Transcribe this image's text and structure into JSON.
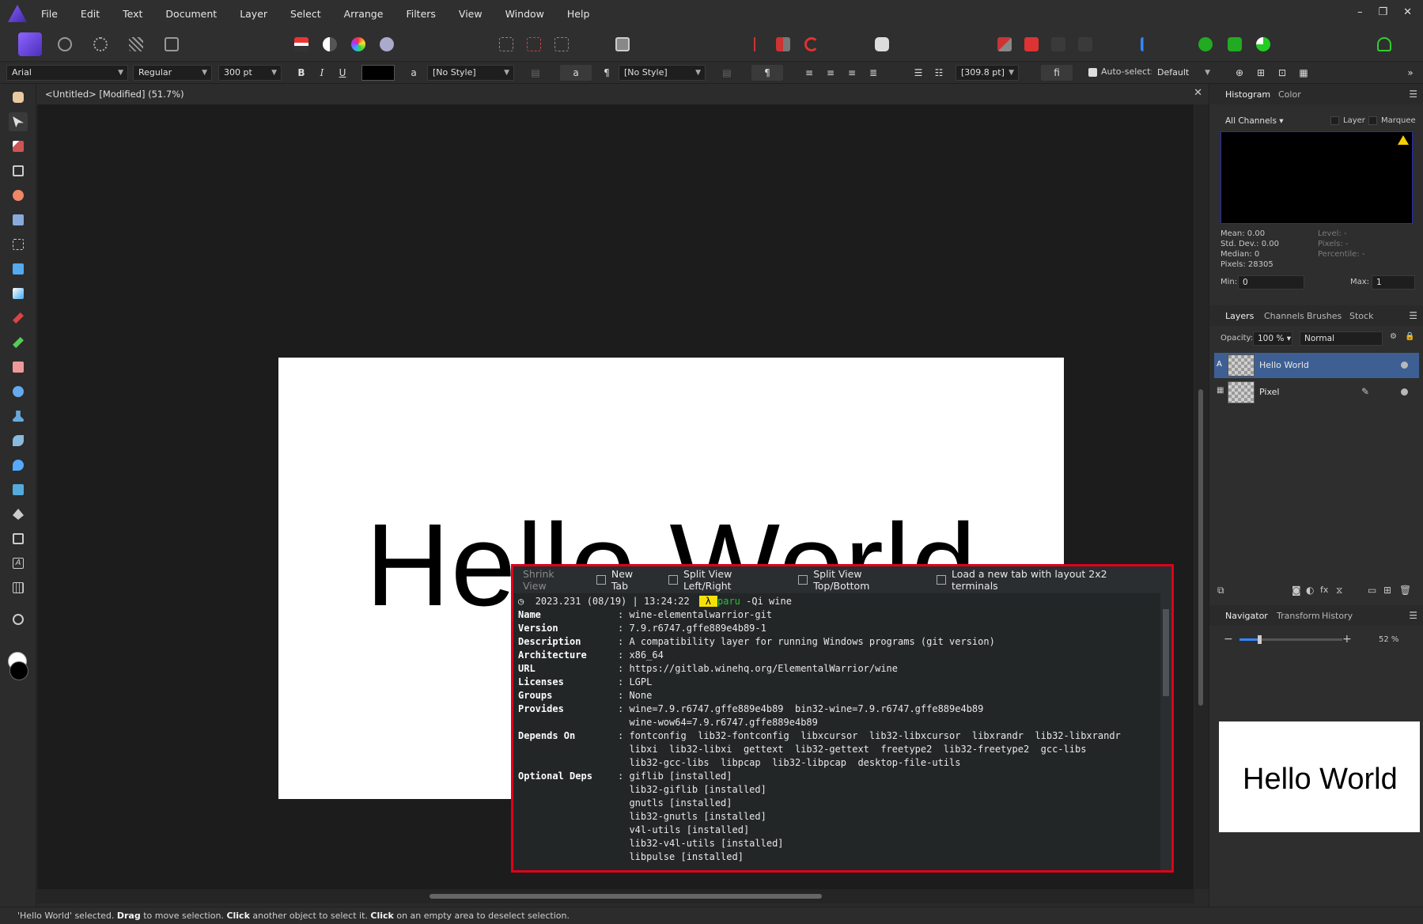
{
  "menubar": {
    "items": [
      "File",
      "Edit",
      "Text",
      "Document",
      "Layer",
      "Select",
      "Arrange",
      "Filters",
      "View",
      "Window",
      "Help"
    ],
    "window_controls": [
      "–",
      "❐",
      "✕"
    ]
  },
  "context_toolbar": {
    "font_family": "Arial",
    "font_style": "Regular",
    "font_size": "300 pt",
    "bold": "B",
    "italic": "I",
    "underline": "U",
    "char_style_glyph": "a",
    "char_style": "[No Style]",
    "para_mark": "¶",
    "para_style": "[No Style]",
    "tracking": "[309.8 pt]",
    "ligature": "fi",
    "auto_select_label": "Auto-select:",
    "auto_select_value": "Default",
    "more": "»"
  },
  "document": {
    "title": "<Untitled> [Modified] (51.7%)",
    "close": "✕",
    "text": "Hello World"
  },
  "terminal": {
    "tabs": [
      "Shrink View",
      "New Tab",
      "Split View Left/Right",
      "Split View Top/Bottom",
      "Load a new tab with layout 2x2 terminals"
    ],
    "prompt": {
      "clock": "◷",
      "datetime": "2023.231 (08/19) | 13:24:22",
      "badge": "λ",
      "command": "paru",
      "args": " -Qi wine"
    },
    "fields": [
      {
        "key": "Name",
        "value": "wine-elementalwarrior-git"
      },
      {
        "key": "Version",
        "value": "7.9.r6747.gffe889e4b89-1"
      },
      {
        "key": "Description",
        "value": "A compatibility layer for running Windows programs (git version)"
      },
      {
        "key": "Architecture",
        "value": "x86_64"
      },
      {
        "key": "URL",
        "value": "https://gitlab.winehq.org/ElementalWarrior/wine"
      },
      {
        "key": "Licenses",
        "value": "LGPL"
      },
      {
        "key": "Groups",
        "value": "None"
      },
      {
        "key": "Provides",
        "value": "wine=7.9.r6747.gffe889e4b89  bin32-wine=7.9.r6747.gffe889e4b89"
      },
      {
        "key": "",
        "value": "wine-wow64=7.9.r6747.gffe889e4b89"
      },
      {
        "key": "Depends On",
        "value": "fontconfig  lib32-fontconfig  libxcursor  lib32-libxcursor  libxrandr  lib32-libxrandr"
      },
      {
        "key": "",
        "value": "libxi  lib32-libxi  gettext  lib32-gettext  freetype2  lib32-freetype2  gcc-libs"
      },
      {
        "key": "",
        "value": "lib32-gcc-libs  libpcap  lib32-libpcap  desktop-file-utils"
      },
      {
        "key": "Optional Deps",
        "value": "giflib [installed]"
      },
      {
        "key": "",
        "value": "lib32-giflib [installed]"
      },
      {
        "key": "",
        "value": "gnutls [installed]"
      },
      {
        "key": "",
        "value": "lib32-gnutls [installed]"
      },
      {
        "key": "",
        "value": "v4l-utils [installed]"
      },
      {
        "key": "",
        "value": "lib32-v4l-utils [installed]"
      },
      {
        "key": "",
        "value": "libpulse [installed]"
      }
    ],
    "separator": ": "
  },
  "histogram": {
    "tabs": [
      "Histogram",
      "Color"
    ],
    "channels": "All Channels",
    "layer_label": "Layer",
    "marquee_label": "Marquee",
    "mean": "Mean: 0.00",
    "std_dev": "Std. Dev.: 0.00",
    "median": "Median: 0",
    "pixels": "Pixels: 28305",
    "level": "Level: -",
    "pixels_dim": "Pixels: -",
    "percentile": "Percentile: -",
    "min_label": "Min:",
    "min_value": "0",
    "max_label": "Max:",
    "max_value": "1"
  },
  "layers": {
    "tabs": [
      "Layers",
      "Channels",
      "Brushes",
      "Stock"
    ],
    "opacity_label": "Opacity:",
    "opacity_value": "100 %",
    "blend_mode": "Normal",
    "items": [
      {
        "name": "Hello World",
        "type_badge": "A"
      },
      {
        "name": "Pixel",
        "type_badge": ""
      }
    ]
  },
  "navigator": {
    "tabs": [
      "Navigator",
      "Transform",
      "History"
    ],
    "zoom_value": "52 %",
    "zoom_level": 0.19,
    "minus": "−",
    "plus": "+",
    "preview_text": "Hello World"
  },
  "statusbar": {
    "part1": "'Hello World' selected. ",
    "drag": "Drag",
    "part2": " to move selection. ",
    "click1": "Click",
    "part3": " another object to select it. ",
    "click2": "Click",
    "part4": " on an empty area to deselect selection."
  },
  "colors": {
    "accent": "#3d5f93",
    "highlight_border": "#e0001a",
    "prompt_badge": "#f5e10a",
    "command_green": "#27c235"
  }
}
